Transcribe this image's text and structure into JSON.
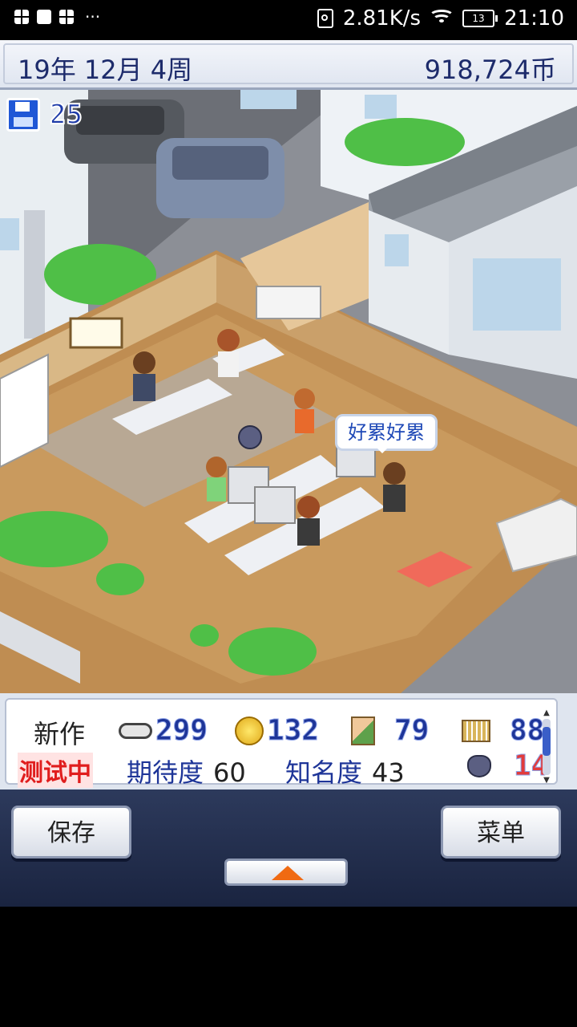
{
  "status_bar": {
    "net_speed": "2.81K/s",
    "battery": "13",
    "time": "21:10",
    "more": "···"
  },
  "top_bar": {
    "date": "19年 12月 4周",
    "money": "918,724币"
  },
  "scene": {
    "save_count": "25",
    "speech_bubble": "好累好累"
  },
  "info_panel": {
    "new_title": "新作",
    "test_status": "测试中",
    "stats": {
      "fun": "299",
      "creativity": "132",
      "graphics": "79",
      "sound": "88",
      "bugs": "14"
    },
    "expectation_label": "期待度",
    "expectation_value": "60",
    "fame_label": "知名度",
    "fame_value": "43"
  },
  "controls": {
    "save_label": "保存",
    "menu_label": "菜单"
  },
  "colors": {
    "accent_blue": "#1e3598",
    "bug_red": "#e23b3b",
    "expand_arrow": "#f06a12"
  }
}
